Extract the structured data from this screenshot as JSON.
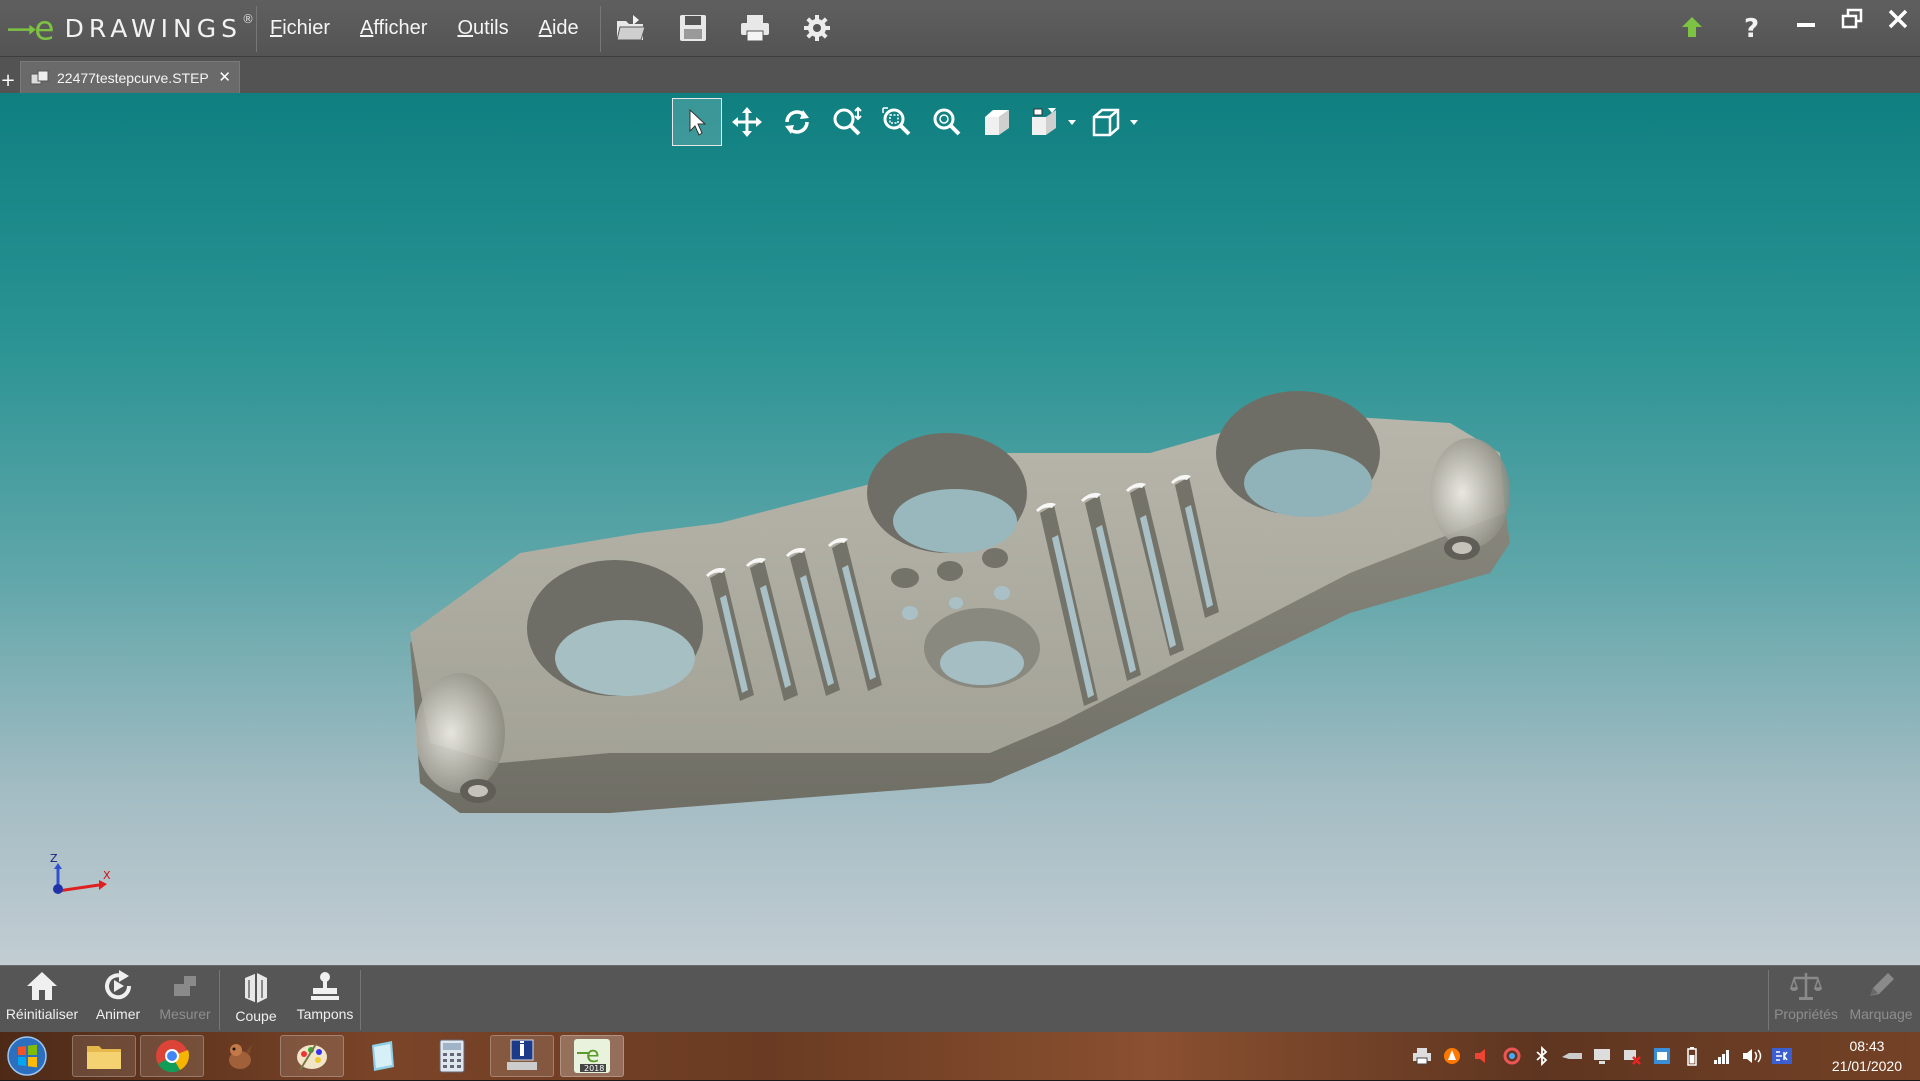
{
  "app": {
    "logo_text": "DRAWINGS",
    "logo_mark": "e",
    "trademark": "®"
  },
  "menu": [
    {
      "first": "F",
      "rest": "ichier"
    },
    {
      "first": "A",
      "rest": "fficher"
    },
    {
      "first": "O",
      "rest": "utils"
    },
    {
      "first": "A",
      "rest": "ide"
    }
  ],
  "icons": {
    "toolbar": [
      "open-file-icon",
      "save-icon",
      "print-icon",
      "settings-gear-icon"
    ],
    "window": [
      "update-arrow-icon",
      "help-icon",
      "minimize-icon",
      "restore-icon",
      "close-icon"
    ],
    "viewport": [
      "select-pointer-icon",
      "pan-icon",
      "rotate-icon",
      "zoom-to-fit-icon",
      "zoom-to-area-icon",
      "zoom-icon",
      "shaded-view-icon",
      "standard-views-icon",
      "display-style-icon"
    ]
  },
  "tabs": [
    {
      "label": "22477testepcurve.STEP",
      "close": "✕",
      "add": "+"
    }
  ],
  "triad": {
    "z": "Z",
    "x": "X"
  },
  "bottom_toolbar": {
    "left": [
      {
        "label": "Réinitialiser",
        "enabled": true
      },
      {
        "label": "Animer",
        "enabled": true
      },
      {
        "label": "Mesurer",
        "enabled": false
      },
      {
        "label": "Coupe",
        "enabled": true
      },
      {
        "label": "Tampons",
        "enabled": true
      }
    ],
    "right": [
      {
        "label": "Propriétés",
        "enabled": false
      },
      {
        "label": "Marquage",
        "enabled": false
      }
    ]
  },
  "taskbar": {
    "badge": "2018",
    "clock_time": "08:43",
    "clock_date": "21/01/2020"
  },
  "colors": {
    "accent_green": "#7dc243",
    "viewport_top": "#0f7f80",
    "viewport_bottom": "#c2cdd3"
  }
}
